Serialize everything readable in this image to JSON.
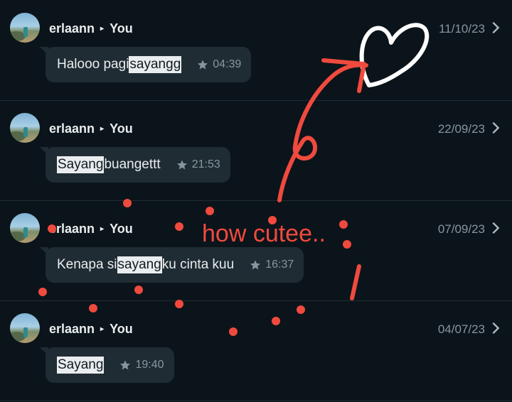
{
  "messages": [
    {
      "sender": "erlaann",
      "recipient": "You",
      "date": "11/10/23",
      "parts": [
        "Halooo pagi ",
        "sayangg",
        ""
      ],
      "time": "04:39"
    },
    {
      "sender": "erlaann",
      "recipient": "You",
      "date": "22/09/23",
      "parts": [
        "",
        "Sayang",
        " buangettt"
      ],
      "time": "21:53"
    },
    {
      "sender": "erlaann",
      "recipient": "You",
      "date": "07/09/23",
      "parts": [
        "Kenapa si ",
        "sayang",
        " ku cinta kuu"
      ],
      "time": "16:37"
    },
    {
      "sender": "erlaann",
      "recipient": "You",
      "date": "04/07/23",
      "parts": [
        "",
        "Sayang",
        ""
      ],
      "time": "19:40"
    }
  ],
  "annotation": {
    "text": "how cutee..",
    "color": "#f04a3e"
  },
  "colors": {
    "background": "#0b141a",
    "bubble": "#202c33",
    "highlight": "#e9edef",
    "muted": "#8696a0"
  },
  "icons": {
    "arrow": "caret-right",
    "star": "star-icon",
    "chevron": "chevron-right-icon"
  }
}
